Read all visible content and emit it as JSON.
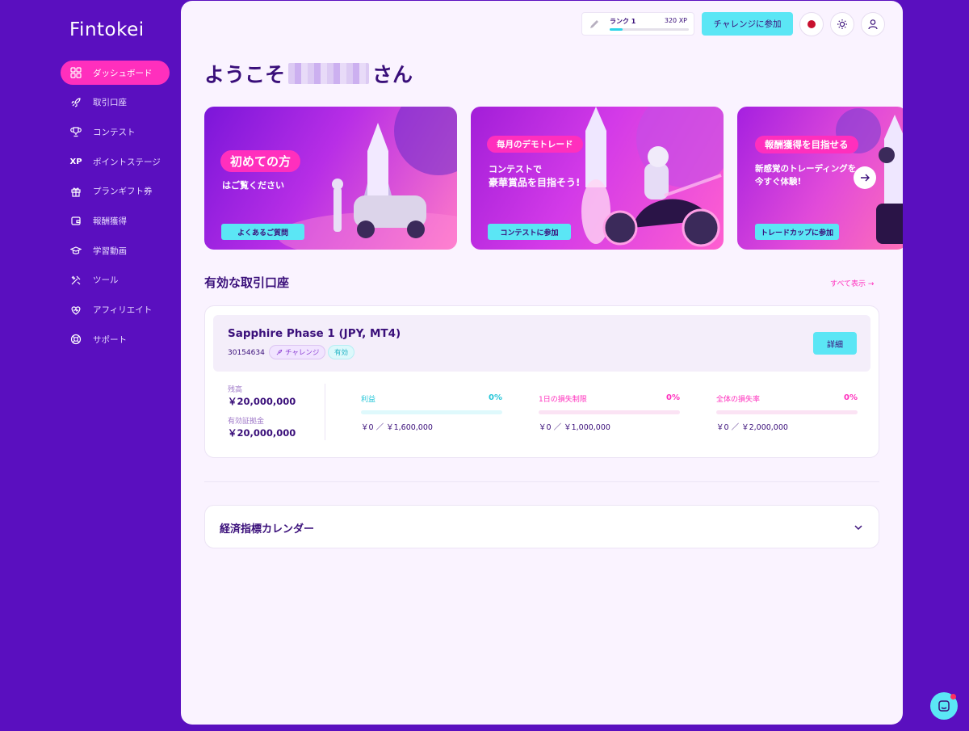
{
  "brand": {
    "logo": "Fintokei"
  },
  "sidebar": {
    "items": [
      {
        "label": "ダッシュボード",
        "icon": "dashboard-icon",
        "active": true
      },
      {
        "label": "取引口座",
        "icon": "rocket-icon",
        "active": false
      },
      {
        "label": "コンテスト",
        "icon": "trophy-icon",
        "active": false
      },
      {
        "label": "ポイントステージ",
        "icon": "xp-icon",
        "glyph": "XP",
        "active": false
      },
      {
        "label": "プランギフト券",
        "icon": "gift-icon",
        "active": false
      },
      {
        "label": "報酬獲得",
        "icon": "wallet-icon",
        "active": false
      },
      {
        "label": "学習動画",
        "icon": "graduation-cap-icon",
        "active": false
      },
      {
        "label": "ツール",
        "icon": "tools-icon",
        "active": false
      },
      {
        "label": "アフィリエイト",
        "icon": "heart-icon",
        "active": false
      },
      {
        "label": "サポート",
        "icon": "lifebuoy-icon",
        "active": false
      }
    ]
  },
  "topbar": {
    "rank_label": "ランク 1",
    "xp": "320 XP",
    "rank_progress": 0.16,
    "join_label": "チャレンジに参加"
  },
  "welcome": {
    "prefix": "ようこそ",
    "suffix": "さん"
  },
  "banners": [
    {
      "pill": "初めての方",
      "text": "はご覧ください",
      "button": "よくあるご質問"
    },
    {
      "pill": "毎月のデモトレード",
      "line1": "コンテストで",
      "line2": "豪華賞品を目指そう!",
      "button": "コンテストに参加"
    },
    {
      "pill": "報酬獲得を目指せる",
      "line1": "新感覚のトレーディングを",
      "line2": "今すぐ体験!",
      "button": "トレードカップに参加"
    }
  ],
  "accounts_section": {
    "title": "有効な取引口座",
    "see_all": "すべて表示 →"
  },
  "account": {
    "name": "Sapphire Phase 1 (JPY, MT4)",
    "id": "30154634",
    "tag_challenge": "チャレンジ",
    "tag_status": "有効",
    "detail_label": "詳細",
    "balance_label": "残高",
    "balance_value": "￥20,000,000",
    "equity_label": "有効証拠金",
    "equity_value": "￥20,000,000",
    "metrics": [
      {
        "label": "利益",
        "percent": "0%",
        "amount": "￥0 ／ ￥1,600,000",
        "color": "#25c6d8",
        "bar": "#dff9fc"
      },
      {
        "label": "1日の損失制限",
        "percent": "0%",
        "amount": "￥0 ／ ￥1,000,000",
        "color": "#ff2fbd",
        "bar": "#fbe3f4"
      },
      {
        "label": "全体の損失率",
        "percent": "0%",
        "amount": "￥0 ／ ￥2,000,000",
        "color": "#ff2fbd",
        "bar": "#fbe3f4"
      }
    ]
  },
  "calendar": {
    "title": "経済指標カレンダー"
  }
}
